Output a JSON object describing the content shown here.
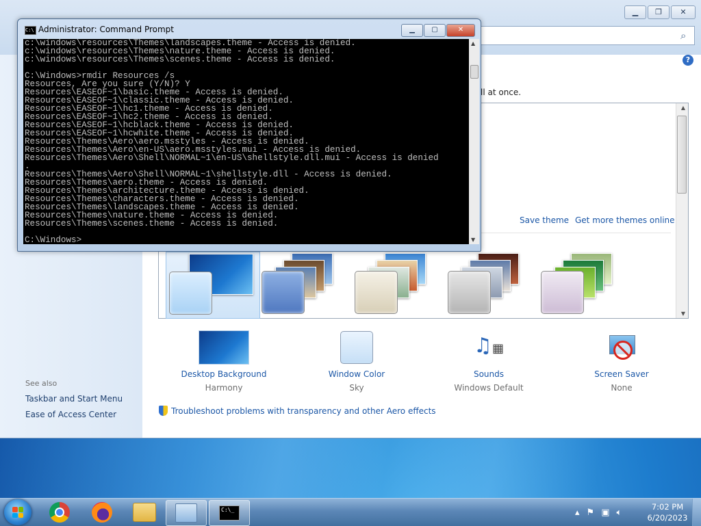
{
  "cmd": {
    "title": "Administrator:  Command Prompt",
    "lines": [
      "c:\\windows\\resources\\Themes\\landscapes.theme - Access is denied.",
      "c:\\windows\\resources\\Themes\\nature.theme - Access is denied.",
      "c:\\windows\\resources\\Themes\\scenes.theme - Access is denied.",
      "",
      "C:\\Windows>rmdir Resources /s",
      "Resources, Are you sure (Y/N)? Y",
      "Resources\\EASEOF~1\\basic.theme - Access is denied.",
      "Resources\\EASEOF~1\\classic.theme - Access is denied.",
      "Resources\\EASEOF~1\\hc1.theme - Access is denied.",
      "Resources\\EASEOF~1\\hc2.theme - Access is denied.",
      "Resources\\EASEOF~1\\hcblack.theme - Access is denied.",
      "Resources\\EASEOF~1\\hcwhite.theme - Access is denied.",
      "Resources\\Themes\\Aero\\aero.msstyles - Access is denied.",
      "Resources\\Themes\\Aero\\en-US\\aero.msstyles.mui - Access is denied.",
      "Resources\\Themes\\Aero\\Shell\\NORMAL~1\\en-US\\shellstyle.dll.mui - Access is denied",
      ".",
      "Resources\\Themes\\Aero\\Shell\\NORMAL~1\\shellstyle.dll - Access is denied.",
      "Resources\\Themes\\aero.theme - Access is denied.",
      "Resources\\Themes\\architecture.theme - Access is denied.",
      "Resources\\Themes\\characters.theme - Access is denied.",
      "Resources\\Themes\\landscapes.theme - Access is denied.",
      "Resources\\Themes\\nature.theme - Access is denied.",
      "Resources\\Themes\\scenes.theme - Access is denied.",
      "",
      "C:\\Windows>"
    ],
    "buttons": {
      "minimize": "▁",
      "maximize": "▢",
      "close": "✕"
    }
  },
  "personalization": {
    "subtitle_fragment": "ll at once.",
    "save_theme": "Save theme",
    "get_more_themes": "Get more themes online",
    "help": "?",
    "see_also": "See also",
    "nav_links": [
      "Taskbar and Start Menu",
      "Ease of Access Center"
    ],
    "items": [
      {
        "label": "Desktop Background",
        "sub": "Harmony",
        "icon": "desktop-background-icon"
      },
      {
        "label": "Window Color",
        "sub": "Sky",
        "icon": "window-color-icon"
      },
      {
        "label": "Sounds",
        "sub": "Windows Default",
        "icon": "sounds-icon"
      },
      {
        "label": "Screen Saver",
        "sub": "None",
        "icon": "screen-saver-icon"
      }
    ],
    "troubleshoot": "Troubleshoot problems with transparency and other Aero effects"
  },
  "taskbar": {
    "apps": [
      "windows-explorer",
      "chrome",
      "firefox",
      "folder",
      "control-panel",
      "command-prompt"
    ],
    "clock_time": "7:02 PM",
    "clock_date": "6/20/2023"
  },
  "colors": {
    "link": "#1a56a6",
    "console_bg": "#000000",
    "console_text": "#c0c0c0",
    "taskbar": "#5c87b7"
  }
}
